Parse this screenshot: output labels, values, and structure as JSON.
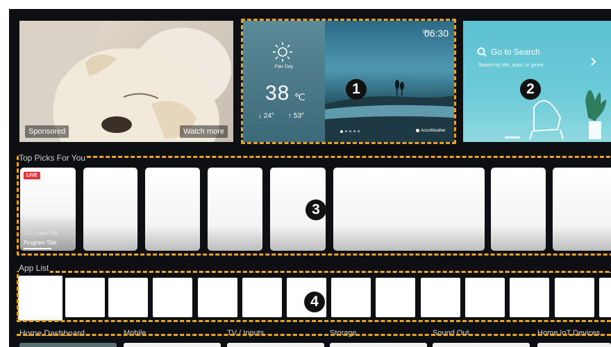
{
  "sponsored": {
    "label": "Sponsored",
    "watch_more": "Watch more"
  },
  "weather": {
    "condition": "Fair Day",
    "temperature": "38",
    "unit": "℃",
    "low": "↓ 24°",
    "high": "↑ 53°",
    "ampm": "PM",
    "time": "06:30",
    "provider": "AccuWeather"
  },
  "search": {
    "title": "Go to Search",
    "subtitle": "Search by title, actor, or genre."
  },
  "top_picks": {
    "label": "Top Picks For You",
    "live_badge": "LIVE",
    "channel_line": "11-2 | Input Title",
    "program_title": "Program Title"
  },
  "app_list": {
    "label": "App List"
  },
  "home_dashboard": {
    "label": "Home Dashboard",
    "items": [
      "Mobile",
      "TV / Inputs",
      "Storage",
      "Sound Out",
      "Home IoT Devices"
    ]
  },
  "callouts": [
    "1",
    "2",
    "3",
    "4"
  ],
  "colors": {
    "dash": "#e8a42a",
    "background": "#0e0f12",
    "live": "#e0393e",
    "search_tile": "#5ec1d1"
  }
}
